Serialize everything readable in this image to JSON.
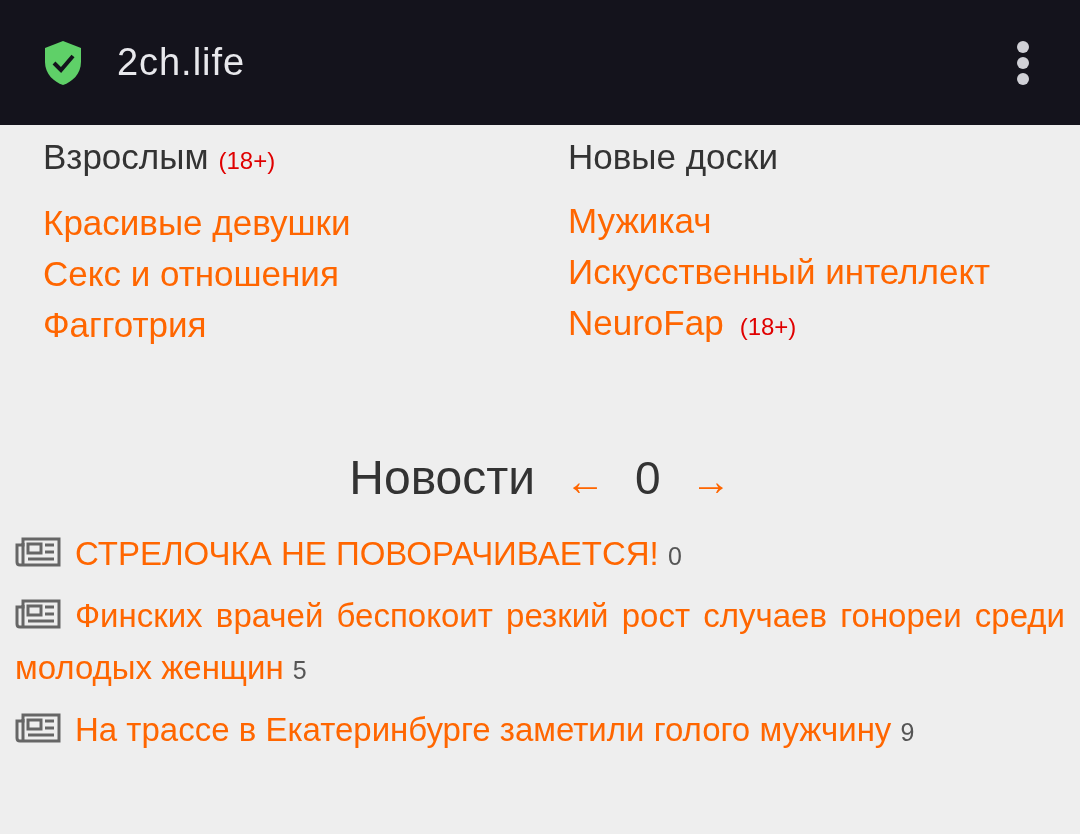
{
  "browser": {
    "url": "2ch.life"
  },
  "sections": [
    {
      "title": "Взрослым",
      "badge": "(18+)",
      "links": [
        {
          "label": "Красивые девушки"
        },
        {
          "label": "Секс и отношения"
        },
        {
          "label": "Фагготрия"
        }
      ]
    },
    {
      "title": "Новые доски",
      "links": [
        {
          "label": "Мужикач"
        },
        {
          "label": "Искусственный интеллект"
        },
        {
          "label": "NeuroFap",
          "badge": "(18+)"
        }
      ]
    }
  ],
  "news": {
    "title": "Новости",
    "prev": "←",
    "page": "0",
    "next": "→",
    "items": [
      {
        "title": "СТРЕЛОЧКА НЕ ПОВОРАЧИВАЕТСЯ!",
        "count": "0"
      },
      {
        "title": "Финских врачей беспокоит резкий рост случаев гонореи среди молодых женщин",
        "count": "5"
      },
      {
        "title": "На трассе в Екатеринбурге заметили голого мужчину",
        "count": "9"
      }
    ]
  }
}
